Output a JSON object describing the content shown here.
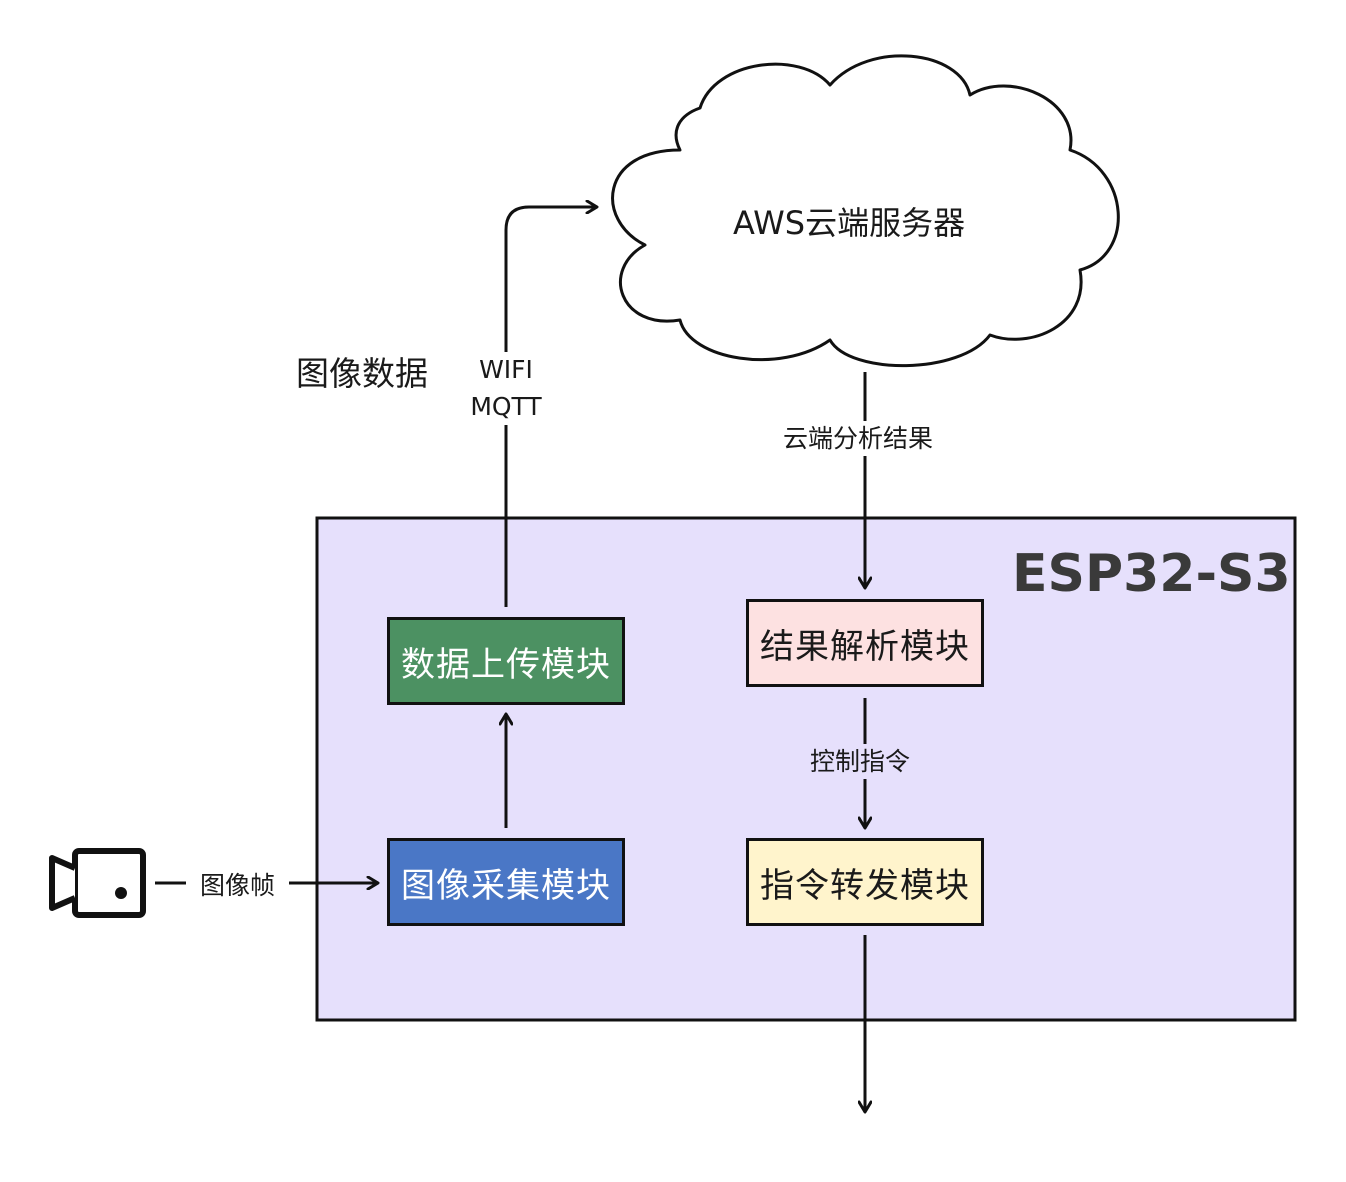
{
  "cloud": {
    "label": "AWS云端服务器"
  },
  "chip": {
    "label": "ESP32-S3",
    "fill": "#e6e0fc"
  },
  "modules": {
    "upload": {
      "label": "数据上传模块",
      "fill": "#4c9162",
      "text_color": "#ffffff"
    },
    "capture": {
      "label": "图像采集模块",
      "fill": "#4a77c6",
      "text_color": "#ffffff"
    },
    "parse": {
      "label": "结果解析模块",
      "fill": "#fde1e1",
      "text_color": "#1a1a1a"
    },
    "dispatch": {
      "label": "指令转发模块",
      "fill": "#fff4cc",
      "text_color": "#1a1a1a"
    }
  },
  "edges": {
    "image_data": "图像数据",
    "protocol_line1": "WIFI",
    "protocol_line2": "MQTT",
    "cloud_result": "云端分析结果",
    "control_command": "控制指令",
    "image_frame": "图像帧"
  },
  "icons": {
    "camera": "video-camera-icon"
  }
}
